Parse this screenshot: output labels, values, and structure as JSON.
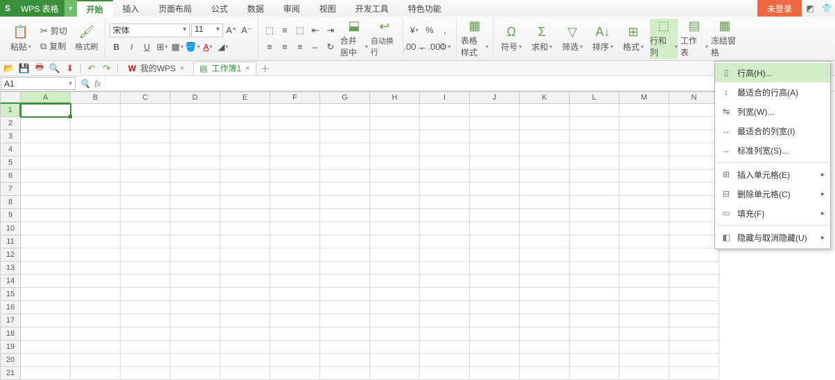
{
  "app": {
    "name": "WPS 表格",
    "login": "未登录"
  },
  "menu": {
    "items": [
      "开始",
      "插入",
      "页面布局",
      "公式",
      "数据",
      "审阅",
      "视图",
      "开发工具",
      "特色功能"
    ],
    "active": 0
  },
  "clipboard": {
    "paste": "粘贴",
    "cut": "剪切",
    "copy": "复制",
    "fmtpainter": "格式刷"
  },
  "font": {
    "name": "宋体",
    "size": "11"
  },
  "align": {
    "mergecenter": "合并居中",
    "wrap": "自动换行"
  },
  "style": {
    "tablestyle": "表格样式"
  },
  "edit": {
    "symbol": "符号",
    "sum": "求和",
    "filter": "筛选",
    "sort": "排序",
    "format": "格式",
    "rowcol": "行和列",
    "worksheet": "工作表",
    "freeze": "冻结窗格"
  },
  "workspace": {
    "mywps": "我的WPS",
    "workbook": "工作簿1"
  },
  "cellref": "A1",
  "grid": {
    "cols": [
      "A",
      "B",
      "C",
      "D",
      "E",
      "F",
      "G",
      "H",
      "I",
      "J",
      "K",
      "L",
      "M",
      "N"
    ],
    "rows": [
      "1",
      "2",
      "3",
      "4",
      "5",
      "6",
      "7",
      "8",
      "9",
      "10",
      "11",
      "12",
      "13",
      "14",
      "15",
      "16",
      "17",
      "18",
      "19",
      "20",
      "21"
    ]
  },
  "dropdown": {
    "items": [
      {
        "label": "行高(H)...",
        "submenu": false,
        "hover": true
      },
      {
        "label": "最适合的行高(A)",
        "submenu": false
      },
      {
        "label": "列宽(W)...",
        "submenu": false
      },
      {
        "label": "最适合的列宽(I)",
        "submenu": false
      },
      {
        "label": "标准列宽(S)...",
        "submenu": false
      },
      {
        "sep": true
      },
      {
        "label": "插入单元格(E)",
        "submenu": true
      },
      {
        "label": "删除单元格(C)",
        "submenu": true
      },
      {
        "label": "填充(F)",
        "submenu": true
      },
      {
        "sep": true
      },
      {
        "label": "隐藏与取消隐藏(U)",
        "submenu": true
      }
    ]
  }
}
